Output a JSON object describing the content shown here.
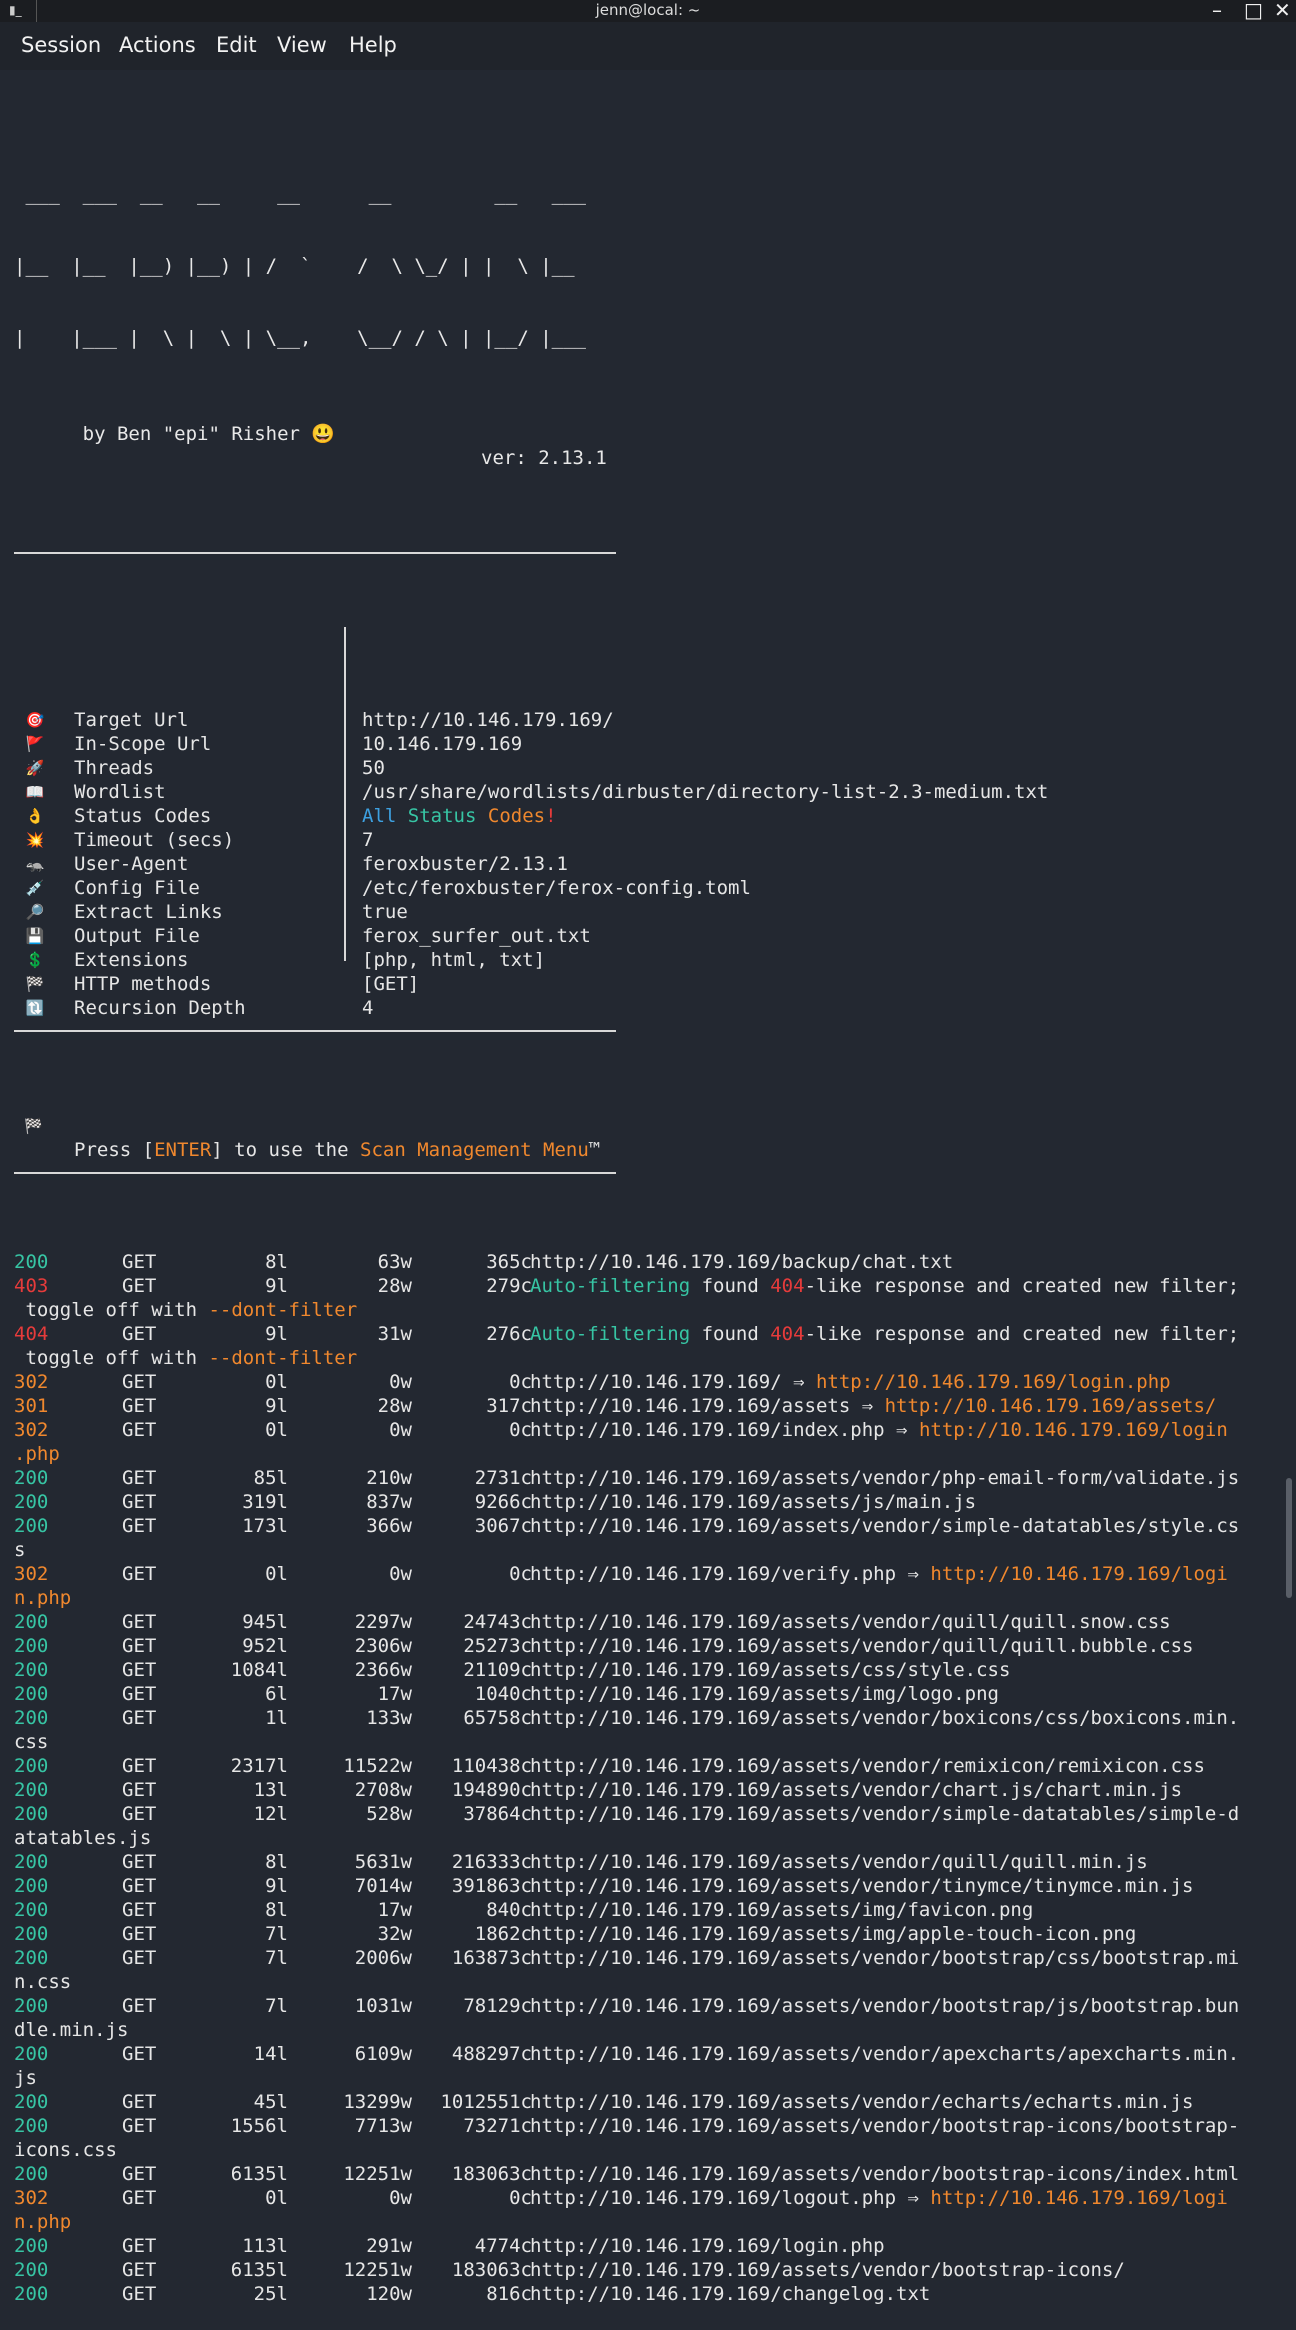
{
  "window": {
    "title": "jenn@local: ~",
    "icon": "terminal-icon",
    "minimize": "–",
    "maximize": "□",
    "close": "✕"
  },
  "menu": [
    "Session",
    "Actions",
    "Edit",
    "View",
    "Help"
  ],
  "banner": {
    "ascii": [
      " ___  ___  __   __     __      __         __   ___",
      "|__  |__  |__) |__) | /  `    /  \\ \\_/ | |  \\ |__",
      "|    |___ |  \\ |  \\ | \\__,    \\__/ / \\ | |__/ |___"
    ],
    "author": "by Ben \"epi\" Risher 😃",
    "version": "ver: 2.13.1"
  },
  "config": [
    {
      "icon": "🎯",
      "key": "Target Url",
      "value": "http://10.146.179.169/"
    },
    {
      "icon": "🚩",
      "key": "In-Scope Url",
      "value": "10.146.179.169"
    },
    {
      "icon": "🚀",
      "key": "Threads",
      "value": "50"
    },
    {
      "icon": "📖",
      "key": "Wordlist",
      "value": "/usr/share/wordlists/dirbuster/directory-list-2.3-medium.txt"
    },
    {
      "icon": "👌",
      "key": "Status Codes",
      "value": ""
    },
    {
      "icon": "💥",
      "key": "Timeout (secs)",
      "value": "7"
    },
    {
      "icon": "🦡",
      "key": "User-Agent",
      "value": "feroxbuster/2.13.1"
    },
    {
      "icon": "💉",
      "key": "Config File",
      "value": "/etc/feroxbuster/ferox-config.toml"
    },
    {
      "icon": "🔎",
      "key": "Extract Links",
      "value": "true"
    },
    {
      "icon": "💾",
      "key": "Output File",
      "value": "ferox_surfer_out.txt"
    },
    {
      "icon": "💲",
      "key": "Extensions",
      "value": "[php, html, txt]"
    },
    {
      "icon": "🏁",
      "key": "HTTP methods",
      "value": "[GET]"
    },
    {
      "icon": "🔃",
      "key": "Recursion Depth",
      "value": "4"
    }
  ],
  "status_codes_value": {
    "all": "All",
    "status": "Status",
    "codes": "Codes",
    "bang": "!"
  },
  "press_enter": {
    "icon": "🏁",
    "pre": "Press [",
    "enter": "ENTER",
    "mid": "] to use the ",
    "menu": "Scan Management Menu",
    "tm": "™"
  },
  "autofilter": {
    "text1": "Auto-filtering",
    "text2": " found ",
    "code": "404",
    "text3": "-like response and created new filter;",
    "cont_pre": " toggle off with ",
    "cont_flag": "--dont-filter"
  },
  "results": [
    {
      "s": "200",
      "m": "GET",
      "l": "8l",
      "w": "63w",
      "c": "365c",
      "url": "http://10.146.179.169/backup/chat.txt"
    },
    {
      "s": "403",
      "m": "GET",
      "l": "9l",
      "w": "28w",
      "c": "279c",
      "auto": true
    },
    {
      "s": "404",
      "m": "GET",
      "l": "9l",
      "w": "31w",
      "c": "276c",
      "auto": true
    },
    {
      "s": "302",
      "m": "GET",
      "l": "0l",
      "w": "0w",
      "c": "0c",
      "url": "http://10.146.179.169/ ⇒ ",
      "redir": "http://10.146.179.169/login.php"
    },
    {
      "s": "301",
      "m": "GET",
      "l": "9l",
      "w": "28w",
      "c": "317c",
      "url": "http://10.146.179.169/assets ⇒ ",
      "redir": "http://10.146.179.169/assets/"
    },
    {
      "s": "302",
      "m": "GET",
      "l": "0l",
      "w": "0w",
      "c": "0c",
      "url": "http://10.146.179.169/index.php ⇒ ",
      "redir": "http://10.146.179.169/login",
      "wrap": ".php",
      "wrapc": "orange"
    },
    {
      "s": "200",
      "m": "GET",
      "l": "85l",
      "w": "210w",
      "c": "2731c",
      "url": "http://10.146.179.169/assets/vendor/php-email-form/validate.js"
    },
    {
      "s": "200",
      "m": "GET",
      "l": "319l",
      "w": "837w",
      "c": "9266c",
      "url": "http://10.146.179.169/assets/js/main.js"
    },
    {
      "s": "200",
      "m": "GET",
      "l": "173l",
      "w": "366w",
      "c": "3067c",
      "url": "http://10.146.179.169/assets/vendor/simple-datatables/style.cs",
      "wrap": "s",
      "wrapc": "white"
    },
    {
      "s": "302",
      "m": "GET",
      "l": "0l",
      "w": "0w",
      "c": "0c",
      "url": "http://10.146.179.169/verify.php ⇒ ",
      "redir": "http://10.146.179.169/logi",
      "wrap": "n.php",
      "wrapc": "orange"
    },
    {
      "s": "200",
      "m": "GET",
      "l": "945l",
      "w": "2297w",
      "c": "24743c",
      "url": "http://10.146.179.169/assets/vendor/quill/quill.snow.css"
    },
    {
      "s": "200",
      "m": "GET",
      "l": "952l",
      "w": "2306w",
      "c": "25273c",
      "url": "http://10.146.179.169/assets/vendor/quill/quill.bubble.css"
    },
    {
      "s": "200",
      "m": "GET",
      "l": "1084l",
      "w": "2366w",
      "c": "21109c",
      "url": "http://10.146.179.169/assets/css/style.css"
    },
    {
      "s": "200",
      "m": "GET",
      "l": "6l",
      "w": "17w",
      "c": "1040c",
      "url": "http://10.146.179.169/assets/img/logo.png"
    },
    {
      "s": "200",
      "m": "GET",
      "l": "1l",
      "w": "133w",
      "c": "65758c",
      "url": "http://10.146.179.169/assets/vendor/boxicons/css/boxicons.min.",
      "wrap": "css",
      "wrapc": "white"
    },
    {
      "s": "200",
      "m": "GET",
      "l": "2317l",
      "w": "11522w",
      "c": "110438c",
      "url": "http://10.146.179.169/assets/vendor/remixicon/remixicon.css"
    },
    {
      "s": "200",
      "m": "GET",
      "l": "13l",
      "w": "2708w",
      "c": "194890c",
      "url": "http://10.146.179.169/assets/vendor/chart.js/chart.min.js"
    },
    {
      "s": "200",
      "m": "GET",
      "l": "12l",
      "w": "528w",
      "c": "37864c",
      "url": "http://10.146.179.169/assets/vendor/simple-datatables/simple-d",
      "wrap": "atatables.js",
      "wrapc": "white"
    },
    {
      "s": "200",
      "m": "GET",
      "l": "8l",
      "w": "5631w",
      "c": "216333c",
      "url": "http://10.146.179.169/assets/vendor/quill/quill.min.js"
    },
    {
      "s": "200",
      "m": "GET",
      "l": "9l",
      "w": "7014w",
      "c": "391863c",
      "url": "http://10.146.179.169/assets/vendor/tinymce/tinymce.min.js"
    },
    {
      "s": "200",
      "m": "GET",
      "l": "8l",
      "w": "17w",
      "c": "840c",
      "url": "http://10.146.179.169/assets/img/favicon.png"
    },
    {
      "s": "200",
      "m": "GET",
      "l": "7l",
      "w": "32w",
      "c": "1862c",
      "url": "http://10.146.179.169/assets/img/apple-touch-icon.png"
    },
    {
      "s": "200",
      "m": "GET",
      "l": "7l",
      "w": "2006w",
      "c": "163873c",
      "url": "http://10.146.179.169/assets/vendor/bootstrap/css/bootstrap.mi",
      "wrap": "n.css",
      "wrapc": "white"
    },
    {
      "s": "200",
      "m": "GET",
      "l": "7l",
      "w": "1031w",
      "c": "78129c",
      "url": "http://10.146.179.169/assets/vendor/bootstrap/js/bootstrap.bun",
      "wrap": "dle.min.js",
      "wrapc": "white"
    },
    {
      "s": "200",
      "m": "GET",
      "l": "14l",
      "w": "6109w",
      "c": "488297c",
      "url": "http://10.146.179.169/assets/vendor/apexcharts/apexcharts.min.",
      "wrap": "js",
      "wrapc": "white"
    },
    {
      "s": "200",
      "m": "GET",
      "l": "45l",
      "w": "13299w",
      "c": "1012551c",
      "url": "http://10.146.179.169/assets/vendor/echarts/echarts.min.js"
    },
    {
      "s": "200",
      "m": "GET",
      "l": "1556l",
      "w": "7713w",
      "c": "73271c",
      "url": "http://10.146.179.169/assets/vendor/bootstrap-icons/bootstrap-",
      "wrap": "icons.css",
      "wrapc": "white"
    },
    {
      "s": "200",
      "m": "GET",
      "l": "6135l",
      "w": "12251w",
      "c": "183063c",
      "url": "http://10.146.179.169/assets/vendor/bootstrap-icons/index.html"
    },
    {
      "s": "302",
      "m": "GET",
      "l": "0l",
      "w": "0w",
      "c": "0c",
      "url": "http://10.146.179.169/logout.php ⇒ ",
      "redir": "http://10.146.179.169/logi",
      "wrap": "n.php",
      "wrapc": "orange"
    },
    {
      "s": "200",
      "m": "GET",
      "l": "113l",
      "w": "291w",
      "c": "4774c",
      "url": "http://10.146.179.169/login.php"
    },
    {
      "s": "200",
      "m": "GET",
      "l": "6135l",
      "w": "12251w",
      "c": "183063c",
      "url": "http://10.146.179.169/assets/vendor/bootstrap-icons/"
    },
    {
      "s": "200",
      "m": "GET",
      "l": "25l",
      "w": "120w",
      "c": "816c",
      "url": "http://10.146.179.169/changelog.txt"
    }
  ],
  "colors": {
    "ok": "#37c5a4",
    "redirect": "#f0882e",
    "error": "#e63b3b",
    "bg": "#232831"
  }
}
